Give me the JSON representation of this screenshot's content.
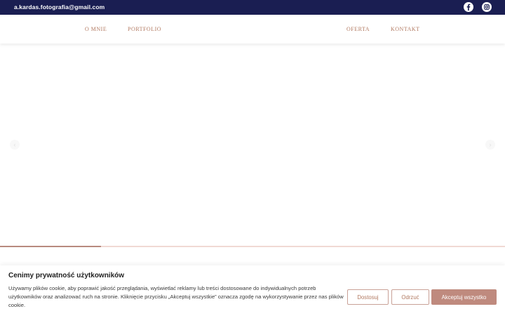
{
  "topbar": {
    "email": "a.kardas.fotografia@gmail.com",
    "icons": [
      "facebook-icon",
      "instagram-icon"
    ],
    "background_color": "#1a1e52"
  },
  "nav": {
    "items": [
      "O MNIE",
      "PORTFOLIO",
      "OFERTA",
      "KONTAKT"
    ],
    "accent_color": "#b27a62"
  },
  "slider": {
    "progress": 0.2
  },
  "cookie_banner": {
    "title": "Cenimy prywatność użytkowników",
    "text": "Używamy plików cookie, aby poprawić jakość przeglądania, wyświetlać reklamy lub treści dostosowane do indywidualnych potrzeb użytkowników oraz analizować ruch na stronie. Kliknięcie przycisku „Akceptuj wszystkie” oznacza zgodę na wykorzystywanie przez nas plików cookie.",
    "customize_label": "Dostosuj",
    "reject_label": "Odrzuć",
    "accept_label": "Akceptuj wszystko",
    "button_color": "#bf8a7e"
  }
}
